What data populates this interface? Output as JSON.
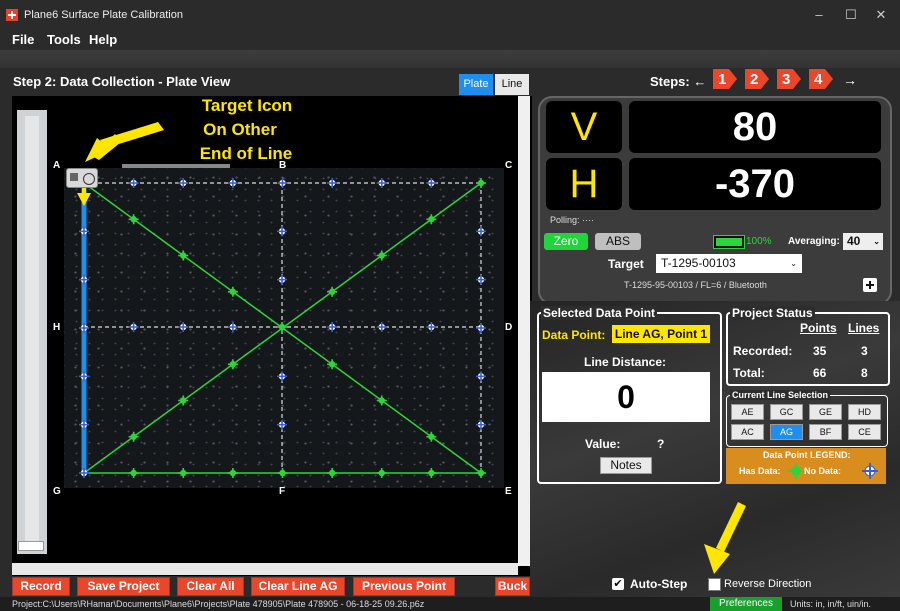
{
  "window": {
    "title": "Plane6 Surface Plate Calibration",
    "minimize": "–",
    "maximize": "☐",
    "close": "✕"
  },
  "menu": {
    "file": "File",
    "tools": "Tools",
    "help": "Help"
  },
  "step_title": "Step 2: Data Collection - Plate View",
  "view_tabs": {
    "plate": "Plate",
    "line": "Line"
  },
  "plate": {
    "corners": {
      "A": "A",
      "B": "B",
      "C": "C",
      "D": "D",
      "E": "E",
      "F": "F",
      "G": "G",
      "H": "H"
    },
    "annotation": [
      "Target Icon",
      "On Other",
      "End of Line"
    ]
  },
  "bottom_buttons": {
    "record": "Record",
    "save_project": "Save Project",
    "clear_all": "Clear All",
    "clear_line": "Clear Line AG",
    "previous_point": "Previous Point",
    "buck": "Buck"
  },
  "status": {
    "project_path": "Project:C:\\Users\\RHamar\\Documents\\Plane6\\Projects\\Plate 478905\\Plate 478905 - 06-18-25 09.26.p6z",
    "preferences": "Preferences",
    "units": "Units: in, in/ft, uin/in."
  },
  "steps": {
    "label": "Steps: ←",
    "arrow_right": "→",
    "numbers": [
      "1",
      "2",
      "3",
      "4"
    ]
  },
  "readout": {
    "v_label": "V",
    "v_value": "80",
    "h_label": "H",
    "h_value": "-370",
    "polling": "Polling: ····",
    "zero": "Zero",
    "abs": "ABS",
    "battery": "100%",
    "averaging_label": "Averaging:",
    "averaging_value": "40",
    "target_label": "Target",
    "target_value": "T-1295-00103",
    "device_info": "T-1295-95-00103 / FL=6 / Bluetooth"
  },
  "selected_point": {
    "title": "Selected Data Point",
    "data_point_label": "Data Point:",
    "data_point_value": "Line AG, Point 1",
    "line_distance_label": "Line Distance:",
    "line_distance_value": "0",
    "value_label": "Value:",
    "value_value": "?",
    "notes": "Notes"
  },
  "project_status": {
    "title": "Project Status",
    "points_hdr": "Points",
    "lines_hdr": "Lines",
    "recorded_label": "Recorded:",
    "recorded_points": "35",
    "recorded_lines": "3",
    "total_label": "Total:",
    "total_points": "66",
    "total_lines": "8"
  },
  "line_selection": {
    "title": "Current Line Selection",
    "lines": [
      "AE",
      "GC",
      "GE",
      "HD",
      "AC",
      "AG",
      "BF",
      "CE"
    ],
    "active": "AG"
  },
  "legend": {
    "title": "Data Point LEGEND:",
    "has_data": "Has Data:",
    "no_data": "No Data:"
  },
  "options": {
    "auto_step": "Auto-Step",
    "reverse_direction": "Reverse Direction"
  },
  "colors": {
    "accent_red": "#e8472c",
    "has_data_green": "#2fd43a",
    "selected_line_blue": "#1e8ff0",
    "highlight_yellow": "#ffe600"
  }
}
